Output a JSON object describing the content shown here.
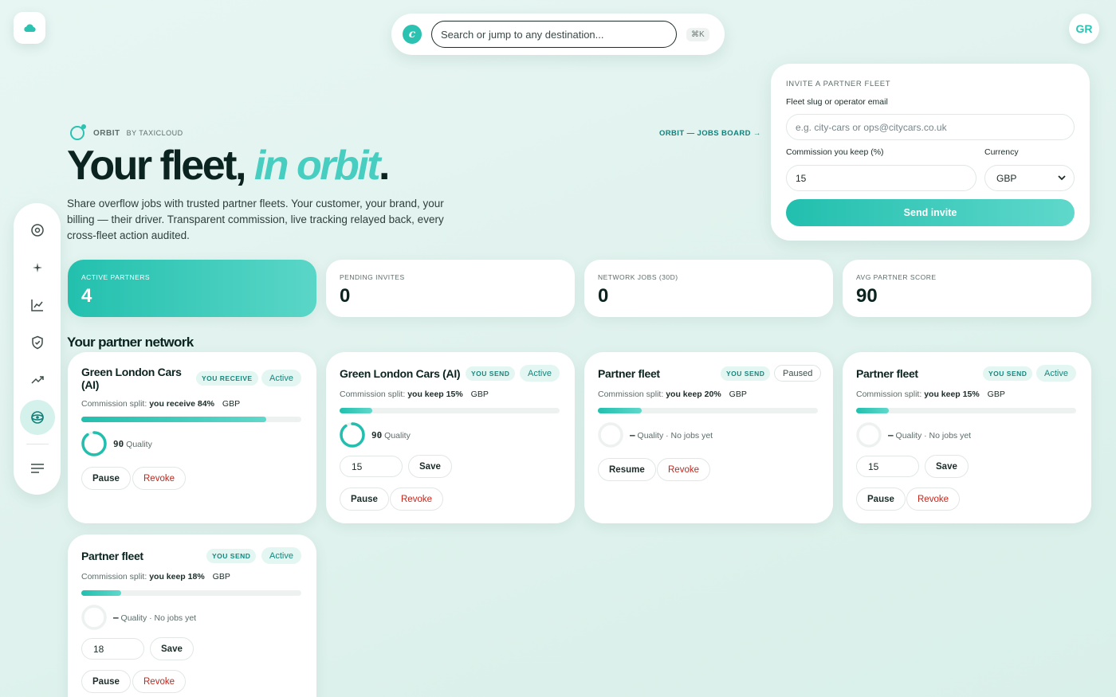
{
  "app": {
    "logo_icon": "cloud-icon",
    "avatar_initials": "GR"
  },
  "search": {
    "placeholder": "Search or jump to any destination...",
    "logo_letter": "c",
    "shortcut": "⌘K"
  },
  "sidebar": {
    "items": [
      {
        "name": "target-icon",
        "active": false
      },
      {
        "name": "sparkle-icon",
        "active": false
      },
      {
        "name": "line-chart-icon",
        "active": false
      },
      {
        "name": "shield-check-icon",
        "active": false
      },
      {
        "name": "trending-up-icon",
        "active": false
      },
      {
        "name": "orbit-icon",
        "active": true
      },
      {
        "name": "menu-icon",
        "active": false
      }
    ]
  },
  "hero": {
    "brand": "ORBIT",
    "brand_by": "BY TAXICLOUD",
    "title_main": "Your fleet, ",
    "title_accent": "in orbit",
    "title_end": ".",
    "subtitle": "Share overflow jobs with trusted partner fleets. Your customer, your brand, your billing — their driver. Transparent commission, live tracking relayed back, every cross-fleet action audited.",
    "jobs_link": "ORBIT — JOBS BOARD →"
  },
  "invite": {
    "title": "INVITE A PARTNER FLEET",
    "slug_label": "Fleet slug or operator email",
    "slug_placeholder": "e.g. city-cars or ops@citycars.co.uk",
    "commission_label": "Commission you keep (%)",
    "commission_value": "15",
    "currency_label": "Currency",
    "currency_value": "GBP",
    "send_label": "Send invite"
  },
  "stats": [
    {
      "label": "ACTIVE PARTNERS",
      "value": "4"
    },
    {
      "label": "PENDING INVITES",
      "value": "0"
    },
    {
      "label": "NETWORK JOBS (30D)",
      "value": "0"
    },
    {
      "label": "AVG PARTNER SCORE",
      "value": "90"
    }
  ],
  "network": {
    "title": "Your partner network",
    "split_prefix": "Commission split:",
    "cards": [
      {
        "name": "Green London Cars (AI)",
        "direction": "YOU RECEIVE",
        "status": "Active",
        "split": "you receive 84%",
        "currency": "GBP",
        "progress": 0.84,
        "quality_score": "90",
        "quality_text": "Quality",
        "score_fraction": 0.9,
        "input_value": "",
        "btn_primary": "Pause",
        "btn_revoke": "Revoke"
      },
      {
        "name": "Green London Cars (AI)",
        "direction": "YOU SEND",
        "status": "Active",
        "split": "you keep 15%",
        "currency": "GBP",
        "progress": 0.15,
        "quality_score": "90",
        "quality_text": "Quality",
        "score_fraction": 0.9,
        "input_value": "15",
        "save_label": "Save",
        "btn_primary": "Pause",
        "btn_revoke": "Revoke"
      },
      {
        "name": "Partner fleet",
        "direction": "YOU SEND",
        "status": "Paused",
        "split": "you keep 20%",
        "currency": "GBP",
        "progress": 0.2,
        "quality_score": "—",
        "quality_text": "Quality · No jobs yet",
        "score_fraction": 0,
        "input_value": "",
        "btn_primary": "Resume",
        "btn_revoke": "Revoke"
      },
      {
        "name": "Partner fleet",
        "direction": "YOU SEND",
        "status": "Active",
        "split": "you keep 15%",
        "currency": "GBP",
        "progress": 0.15,
        "quality_score": "—",
        "quality_text": "Quality · No jobs yet",
        "score_fraction": 0,
        "input_value": "15",
        "save_label": "Save",
        "btn_primary": "Pause",
        "btn_revoke": "Revoke"
      },
      {
        "name": "Partner fleet",
        "direction": "YOU SEND",
        "status": "Active",
        "split": "you keep 18%",
        "currency": "GBP",
        "progress": 0.18,
        "quality_score": "—",
        "quality_text": "Quality · No jobs yet",
        "score_fraction": 0,
        "input_value": "18",
        "save_label": "Save",
        "btn_primary": "Pause",
        "btn_revoke": "Revoke"
      }
    ]
  },
  "colors": {
    "accent": "#2bc2b2",
    "accent_light": "#5fd8cb",
    "revoke": "#c2271d",
    "ink": "#0b2420"
  }
}
